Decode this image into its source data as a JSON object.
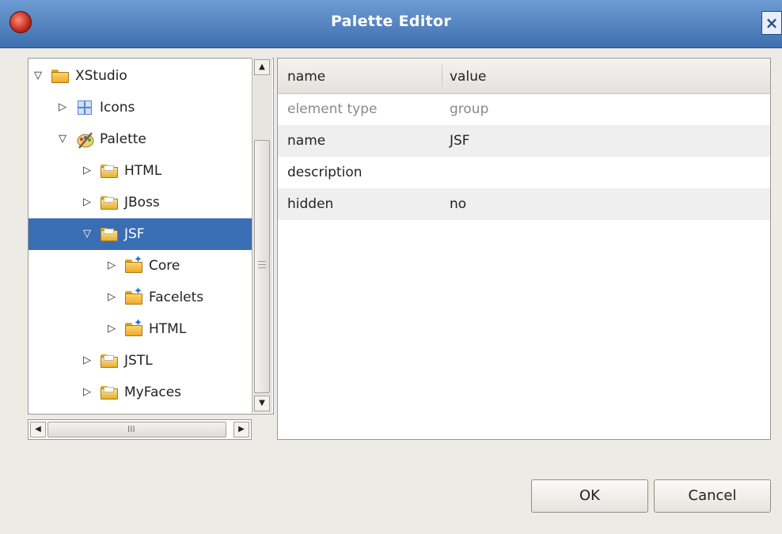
{
  "window": {
    "title": "Palette Editor"
  },
  "tree": [
    {
      "label": "XStudio",
      "level": 0,
      "expanded": true,
      "icon": "open-folder-icon"
    },
    {
      "label": "Icons",
      "level": 1,
      "expanded": false,
      "icon": "icons-icon"
    },
    {
      "label": "Palette",
      "level": 1,
      "expanded": true,
      "icon": "palette-icon"
    },
    {
      "label": "HTML",
      "level": 2,
      "expanded": false,
      "icon": "folder-icon"
    },
    {
      "label": "JBoss",
      "level": 2,
      "expanded": false,
      "icon": "folder-icon"
    },
    {
      "label": "JSF",
      "level": 2,
      "expanded": true,
      "icon": "folder-icon",
      "selected": true
    },
    {
      "label": "Core",
      "level": 3,
      "expanded": false,
      "icon": "open-folder-icon"
    },
    {
      "label": "Facelets",
      "level": 3,
      "expanded": false,
      "icon": "open-folder-icon"
    },
    {
      "label": "HTML",
      "level": 3,
      "expanded": false,
      "icon": "open-folder-icon"
    },
    {
      "label": "JSTL",
      "level": 2,
      "expanded": false,
      "icon": "folder-icon"
    },
    {
      "label": "MyFaces",
      "level": 2,
      "expanded": false,
      "icon": "folder-icon"
    },
    {
      "label": "",
      "level": 2,
      "expanded": false,
      "icon": "folder-icon",
      "partial": true
    }
  ],
  "scroll": {
    "h_glyph": "III"
  },
  "properties": {
    "headers": [
      "name",
      "value"
    ],
    "rows": [
      {
        "name": "element type",
        "value": "group",
        "readonly": true
      },
      {
        "name": "name",
        "value": "JSF"
      },
      {
        "name": "description",
        "value": ""
      },
      {
        "name": "hidden",
        "value": "no"
      }
    ]
  },
  "buttons": {
    "ok": "OK",
    "cancel": "Cancel"
  },
  "colors": {
    "title_bar": "#4f7fc0",
    "selection": "#3a6eb4",
    "dialog_bg": "#ecebe6"
  }
}
